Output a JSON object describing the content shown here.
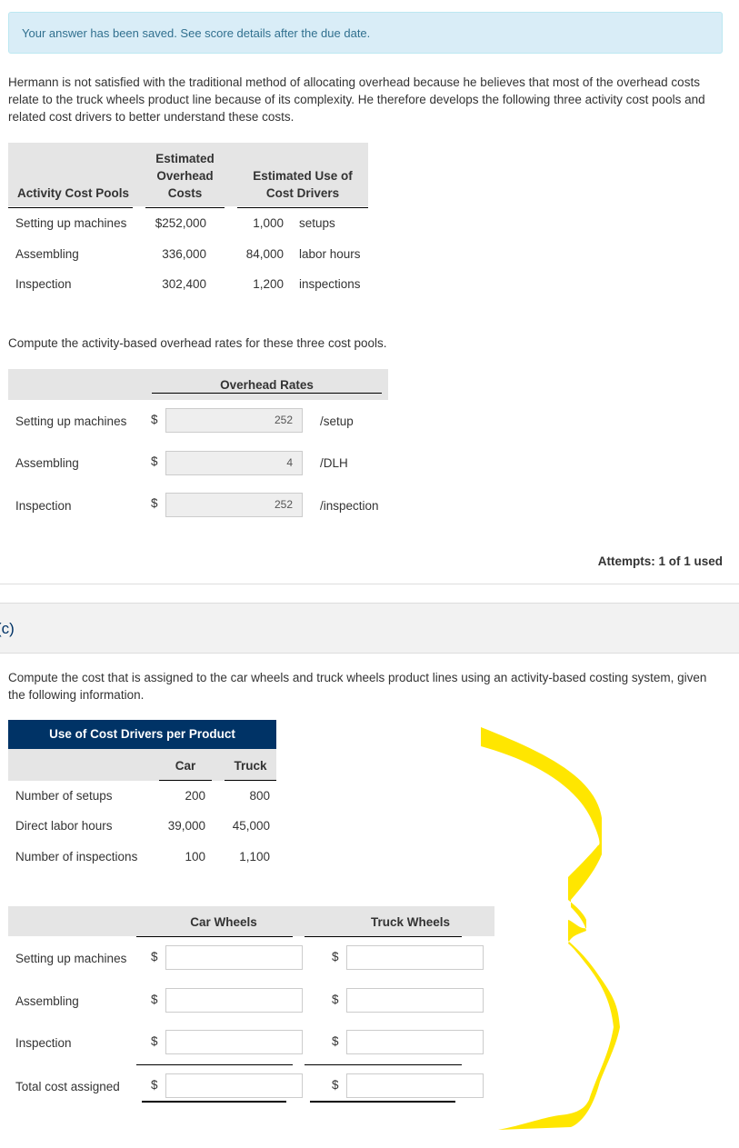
{
  "banner": {
    "message": "Your answer has been saved. See score details after the due date."
  },
  "intro": "Hermann is not satisfied with the traditional method of allocating overhead because he believes that most of the overhead costs relate to the truck wheels product line because of its complexity. He therefore develops the following three activity cost pools and related cost drivers to better understand these costs.",
  "cost_pools_table": {
    "headers": {
      "pool": "Activity Cost Pools",
      "overhead_line1": "Estimated",
      "overhead_line2": "Overhead",
      "overhead_line3": "Costs",
      "drivers_line1": "Estimated Use of",
      "drivers_line2": "Cost Drivers"
    },
    "rows": [
      {
        "pool": "Setting up machines",
        "cost": "$252,000",
        "qty": "1,000",
        "unit": "setups"
      },
      {
        "pool": "Assembling",
        "cost": "336,000",
        "qty": "84,000",
        "unit": "labor hours"
      },
      {
        "pool": "Inspection",
        "cost": "302,400",
        "qty": "1,200",
        "unit": "inspections"
      }
    ]
  },
  "part_b": {
    "instruction": "Compute the activity-based overhead rates for these three cost pools.",
    "header": "Overhead Rates",
    "currency": "$",
    "rows": [
      {
        "label": "Setting up machines",
        "value": "252",
        "unit": "/setup"
      },
      {
        "label": "Assembling",
        "value": "4",
        "unit": "/DLH"
      },
      {
        "label": "Inspection",
        "value": "252",
        "unit": "/inspection"
      }
    ],
    "attempts": "Attempts: 1 of 1 used"
  },
  "part_c": {
    "label": "(c)",
    "instruction": "Compute the cost that is assigned to the car wheels and truck wheels product lines using an activity-based costing system, given the following information.",
    "drivers_table": {
      "title": "Use of Cost Drivers per Product",
      "col_car": "Car",
      "col_truck": "Truck",
      "rows": [
        {
          "label": "Number of setups",
          "car": "200",
          "truck": "800"
        },
        {
          "label": "Direct labor hours",
          "car": "39,000",
          "truck": "45,000"
        },
        {
          "label": "Number of inspections",
          "car": "100",
          "truck": "1,100"
        }
      ]
    },
    "answer_table": {
      "col_car": "Car Wheels",
      "col_truck": "Truck Wheels",
      "currency": "$",
      "rows": [
        {
          "label": "Setting up machines",
          "car": "",
          "truck": ""
        },
        {
          "label": "Assembling",
          "car": "",
          "truck": ""
        },
        {
          "label": "Inspection",
          "car": "",
          "truck": ""
        },
        {
          "label": "Total cost assigned",
          "car": "",
          "truck": ""
        }
      ]
    }
  },
  "annotation": {
    "color": "#ffe600"
  }
}
